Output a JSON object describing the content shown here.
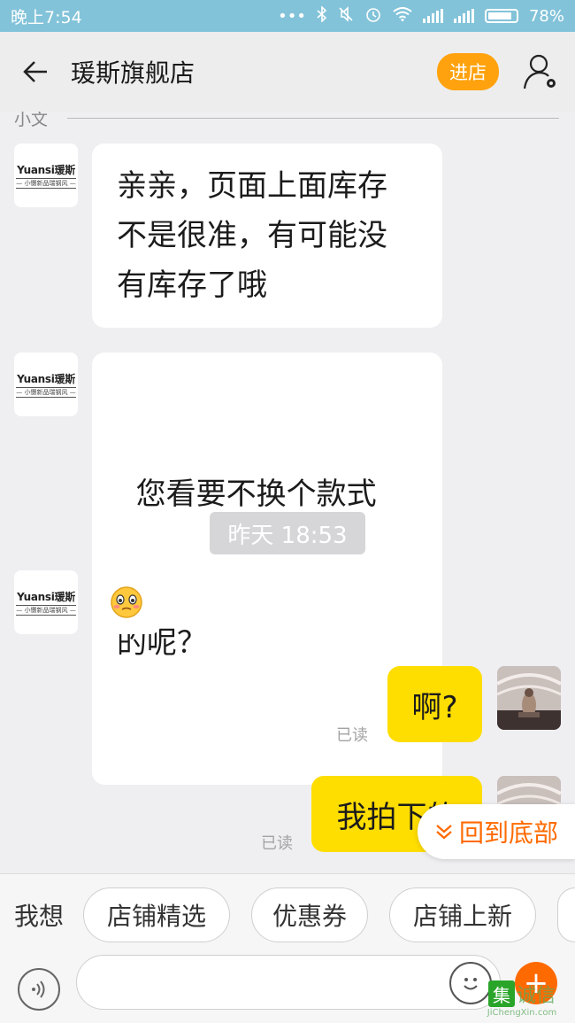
{
  "status_bar": {
    "time": "晚上7:54",
    "battery": "78%",
    "icons": [
      "more-dots-icon",
      "bluetooth-icon",
      "mute-icon",
      "alarm-icon",
      "wifi-icon",
      "signal-icon",
      "signal-icon",
      "battery-icon"
    ]
  },
  "header": {
    "title": "瑗斯旗舰店",
    "shop_button": "进店",
    "icons": [
      "back-arrow-icon",
      "user-settings-icon"
    ]
  },
  "chat": {
    "sender_name": "小文",
    "store_avatar": {
      "logo": "Yuansi瑗斯",
      "slogan": "— 小慑新品瑞钢风 —"
    },
    "messages": [
      {
        "side": "left",
        "lines": [
          "亲亲，页面上面库存",
          "不是很准，有可能没",
          "有库存了哦"
        ]
      },
      {
        "side": "left",
        "lines": [
          "  您看要不换个款式",
          "的呢？"
        ]
      },
      {
        "side": "left",
        "type": "emoji",
        "emoji": "😳"
      },
      {
        "side": "right",
        "text": "啊?",
        "read": "已读"
      },
      {
        "side": "right",
        "text": "我拍下的",
        "read": "已读"
      }
    ],
    "timestamp": "昨天 18:53",
    "scroll_to_bottom": "回到底部"
  },
  "quick_bar": {
    "label": "我想",
    "chips": [
      "店铺精选",
      "优惠券",
      "店铺上新"
    ]
  },
  "input_bar": {
    "placeholder": "",
    "icons": [
      "voice-icon",
      "emoji-icon",
      "plus-icon"
    ]
  },
  "watermark": {
    "mark": "集",
    "text": "诚信",
    "sub": "JiChengXin.com"
  }
}
